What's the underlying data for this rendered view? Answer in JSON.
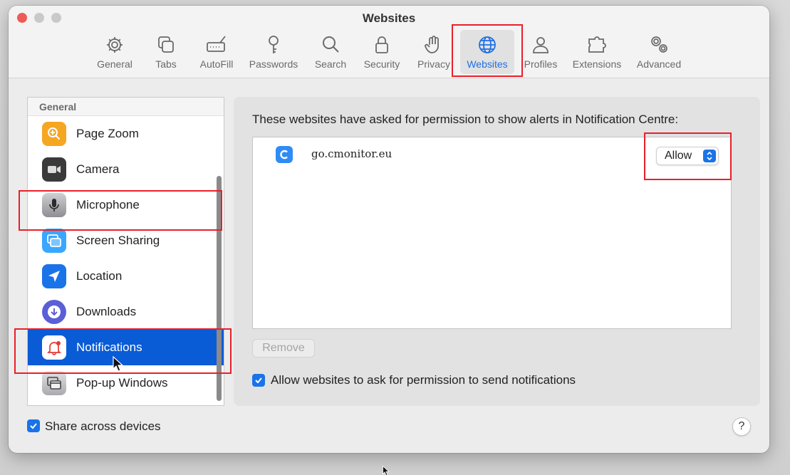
{
  "window": {
    "title": "Websites"
  },
  "toolbar": {
    "items": [
      {
        "label": "General",
        "icon": "gear-icon"
      },
      {
        "label": "Tabs",
        "icon": "tabs-icon"
      },
      {
        "label": "AutoFill",
        "icon": "pencil-field-icon"
      },
      {
        "label": "Passwords",
        "icon": "key-icon"
      },
      {
        "label": "Search",
        "icon": "search-icon"
      },
      {
        "label": "Security",
        "icon": "lock-icon"
      },
      {
        "label": "Privacy",
        "icon": "hand-icon"
      },
      {
        "label": "Websites",
        "icon": "globe-icon",
        "active": true
      },
      {
        "label": "Profiles",
        "icon": "person-icon"
      },
      {
        "label": "Extensions",
        "icon": "puzzle-icon"
      },
      {
        "label": "Advanced",
        "icon": "gears-icon"
      }
    ]
  },
  "sidebar": {
    "header": "General",
    "items": [
      {
        "label": "Page Zoom",
        "icon": "zoom-icon",
        "color": "#f5a623"
      },
      {
        "label": "Camera",
        "icon": "camera-icon",
        "color": "#3a3a3a"
      },
      {
        "label": "Microphone",
        "icon": "microphone-icon",
        "color": "#8e8e93"
      },
      {
        "label": "Screen Sharing",
        "icon": "screen-icon",
        "color": "#39a7ff"
      },
      {
        "label": "Location",
        "icon": "location-arrow-icon",
        "color": "#1a73e8"
      },
      {
        "label": "Downloads",
        "icon": "download-icon",
        "color": "#5b5fd6"
      },
      {
        "label": "Notifications",
        "icon": "bell-icon",
        "color": "#ffffff",
        "selected": true
      },
      {
        "label": "Pop-up Windows",
        "icon": "popup-window-icon",
        "color": "#8e8e93"
      }
    ]
  },
  "panel": {
    "heading": "These websites have asked for permission to show alerts in Notification Centre:",
    "sites": [
      {
        "name": "go.cmonitor.eu",
        "permission": "Allow"
      }
    ],
    "remove_label": "Remove",
    "allow_ask_label": "Allow websites to ask for permission to send notifications",
    "allow_ask_checked": true
  },
  "footer": {
    "share_label": "Share across devices",
    "share_checked": true,
    "help_label": "?"
  },
  "colors": {
    "accent": "#1a73e8",
    "selection": "#0a5bd6",
    "highlight": "#e8202a"
  }
}
